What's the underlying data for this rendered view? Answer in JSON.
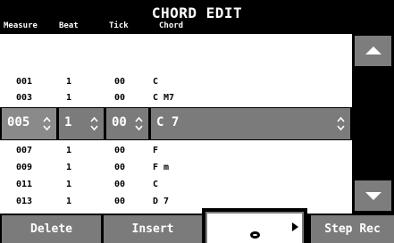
{
  "header": {
    "title": "CHORD EDIT",
    "columns": {
      "measure": "Measure",
      "beat": "Beat",
      "tick": "Tick",
      "chord": "Chord"
    }
  },
  "rows_above": [
    {
      "measure": "001",
      "beat": "1",
      "tick": "00",
      "chord": "C"
    },
    {
      "measure": "003",
      "beat": "1",
      "tick": "00",
      "chord": "C M7"
    }
  ],
  "selected": {
    "measure": "005",
    "beat": "1",
    "tick": "00",
    "chord": "C 7"
  },
  "rows_below": [
    {
      "measure": "007",
      "beat": "1",
      "tick": "00",
      "chord": "F"
    },
    {
      "measure": "009",
      "beat": "1",
      "tick": "00",
      "chord": "F m"
    },
    {
      "measure": "011",
      "beat": "1",
      "tick": "00",
      "chord": "C"
    },
    {
      "measure": "013",
      "beat": "1",
      "tick": "00",
      "chord": "D 7"
    }
  ],
  "buttons": {
    "delete": "Delete",
    "insert": "Insert",
    "step_rec": "Step Rec"
  },
  "icons": {
    "scroll_up": "triangle-up-icon",
    "scroll_down": "triangle-down-icon",
    "spin": "up-down-chevron-icon",
    "play": "play-icon",
    "note": "whole-note-icon"
  },
  "colors": {
    "header_bg": "#000000",
    "field_bg": "#7b7b7b",
    "button_bg": "#7b7b7b",
    "text_light": "#ffffff"
  }
}
